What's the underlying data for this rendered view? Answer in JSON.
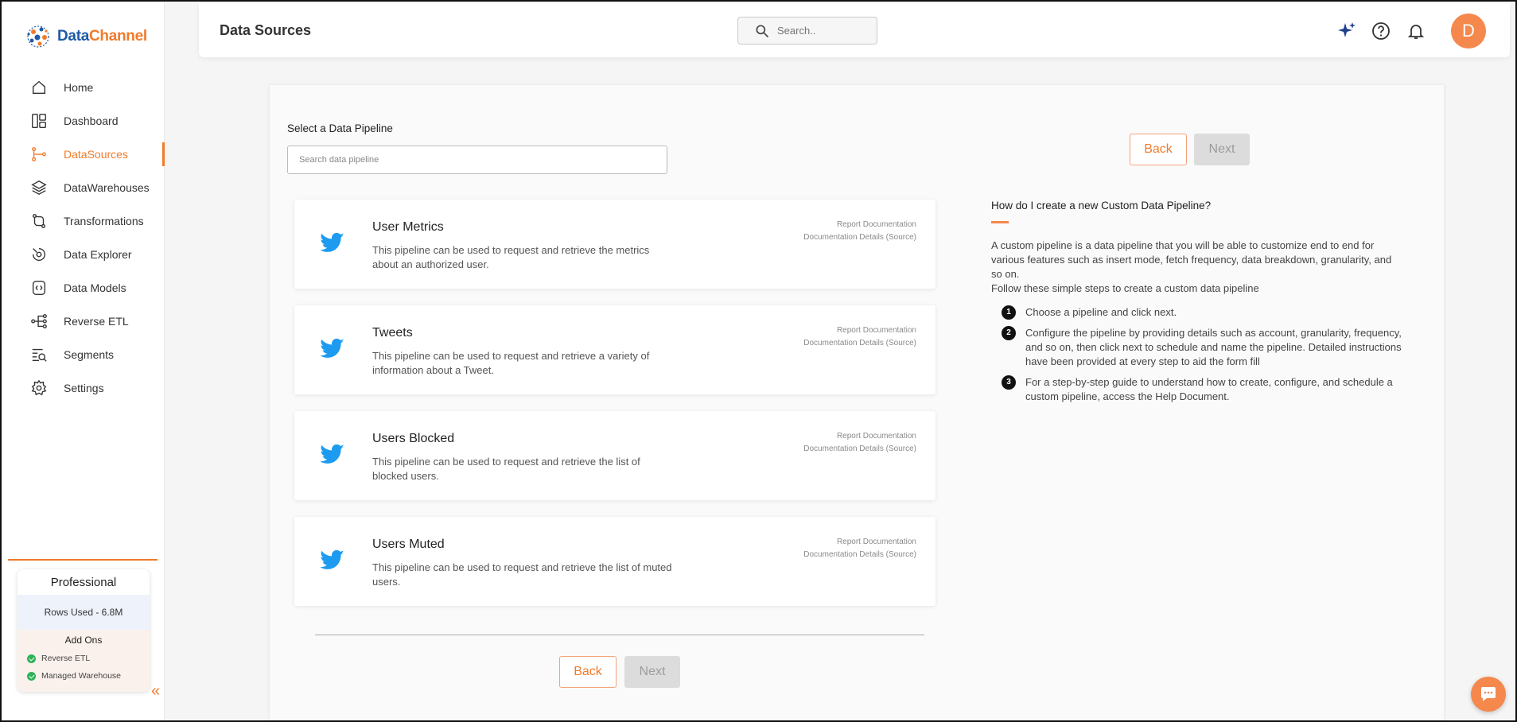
{
  "brand": {
    "name_part1": "Data",
    "name_part2": "Channel"
  },
  "header": {
    "title": "Data Sources",
    "search_placeholder": "Search..",
    "avatar_letter": "D"
  },
  "sidebar": {
    "items": [
      {
        "label": "Home",
        "icon": "home-icon"
      },
      {
        "label": "Dashboard",
        "icon": "dashboard-icon"
      },
      {
        "label": "DataSources",
        "icon": "datasources-icon",
        "active": true
      },
      {
        "label": "DataWarehouses",
        "icon": "layers-icon"
      },
      {
        "label": "Transformations",
        "icon": "transform-icon"
      },
      {
        "label": "Data Explorer",
        "icon": "explorer-icon"
      },
      {
        "label": "Data Models",
        "icon": "models-icon"
      },
      {
        "label": "Reverse ETL",
        "icon": "reverse-etl-icon"
      },
      {
        "label": "Segments",
        "icon": "segments-icon"
      },
      {
        "label": "Settings",
        "icon": "gear-icon"
      }
    ],
    "plan": {
      "title": "Professional",
      "rows_used": "Rows Used - 6.8M",
      "addons_title": "Add Ons",
      "addons": [
        "Reverse ETL",
        "Managed Warehouse"
      ]
    }
  },
  "main": {
    "select_label": "Select a Data Pipeline",
    "search_placeholder": "Search data pipeline",
    "back_label": "Back",
    "next_label": "Next",
    "pipelines": [
      {
        "title": "User Metrics",
        "desc": "This pipeline can be used to request and retrieve the metrics about an authorized user.",
        "link1": "Report Documentation",
        "link2": "Documentation Details (Source)"
      },
      {
        "title": "Tweets",
        "desc": "This pipeline can be used to request and retrieve a variety of information about a Tweet.",
        "link1": "Report Documentation",
        "link2": "Documentation Details (Source)"
      },
      {
        "title": "Users Blocked",
        "desc": "This pipeline can be used to request and retrieve the list of blocked users.",
        "link1": "Report Documentation",
        "link2": "Documentation Details (Source)"
      },
      {
        "title": "Users Muted",
        "desc": "This pipeline can be used to request and retrieve the list of muted users.",
        "link1": "Report Documentation",
        "link2": "Documentation Details (Source)"
      }
    ]
  },
  "help": {
    "title": "How do I create a new Custom Data Pipeline?",
    "intro": "A custom pipeline is a data pipeline that you will be able to customize end to end for various features such as insert mode, fetch frequency, data breakdown, granularity, and so on.",
    "intro2": "Follow these simple steps to create a custom data pipeline",
    "steps": [
      {
        "num": "1",
        "text": "Choose a pipeline and click next."
      },
      {
        "num": "2",
        "text": "Configure the pipeline by providing details such as account, granularity, frequency, and so on, then click next to schedule and name the pipeline. Detailed instructions have been provided at every step to aid the form fill"
      },
      {
        "num": "3",
        "text": "For a step-by-step guide to understand how to create, configure, and schedule a custom pipeline, access the Help Document."
      }
    ]
  },
  "colors": {
    "accent": "#f07b2b",
    "brand_blue": "#1f5aa6",
    "twitter": "#1d9bf0"
  }
}
